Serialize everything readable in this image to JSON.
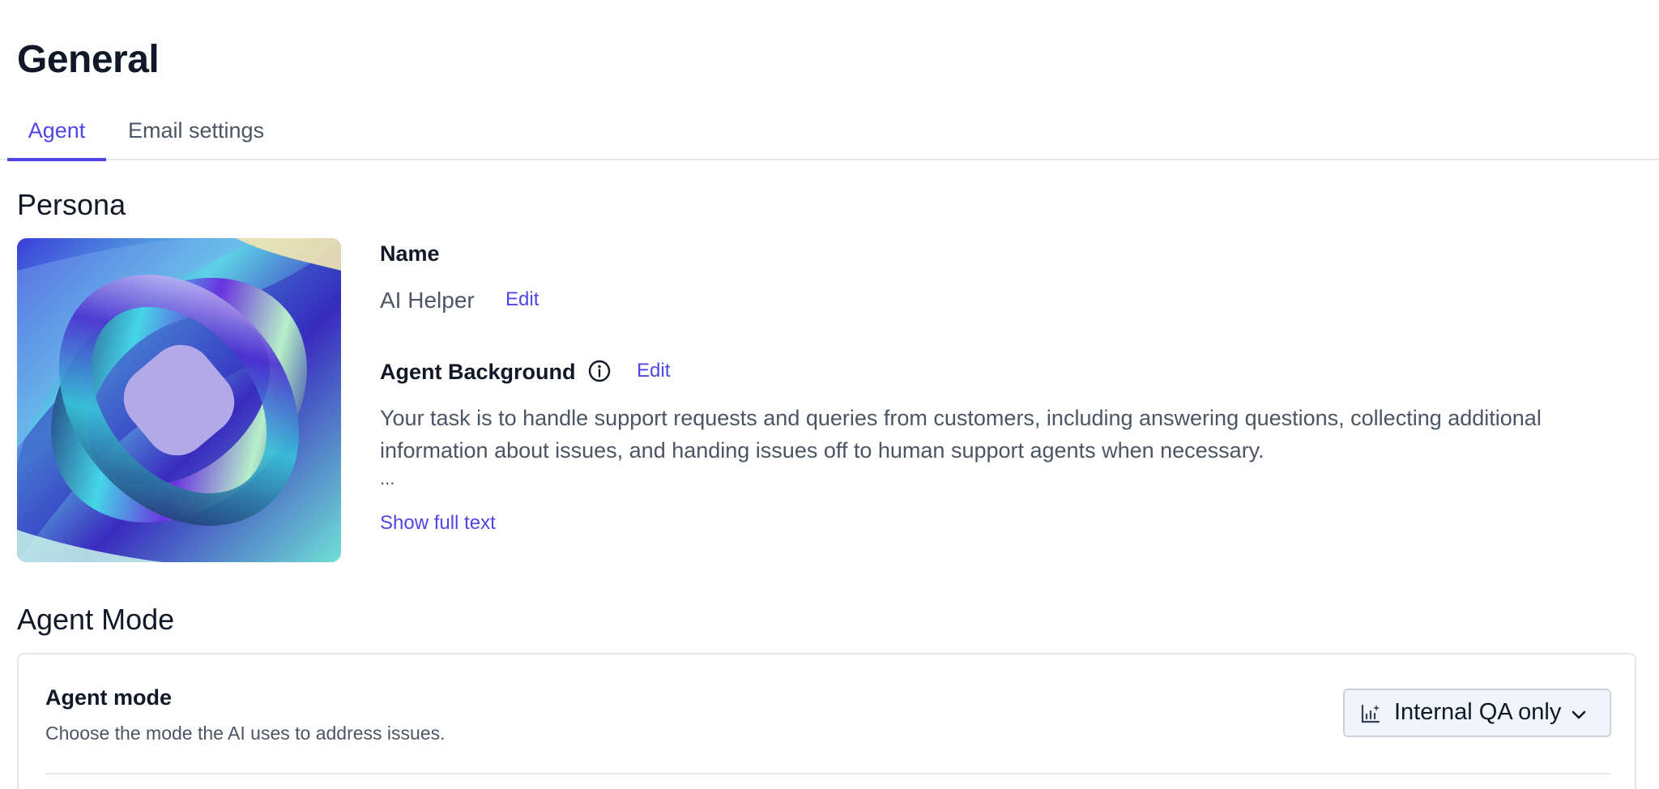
{
  "page": {
    "title": "General"
  },
  "tabs": [
    {
      "label": "Agent",
      "active": true
    },
    {
      "label": "Email settings",
      "active": false
    }
  ],
  "persona": {
    "section_title": "Persona",
    "avatar_icon": "abstract-iridescent-knot-image",
    "name_label": "Name",
    "name_value": "AI Helper",
    "name_edit": "Edit",
    "background_label": "Agent Background",
    "background_info_icon": "info-icon",
    "background_edit": "Edit",
    "background_text": "Your task is to handle support requests and queries from customers, including answering questions, collecting additional information about issues, and handing issues off to human support agents when necessary.",
    "background_ellipsis": "...",
    "show_full_text": "Show full text"
  },
  "agent_mode": {
    "section_title": "Agent Mode",
    "label": "Agent mode",
    "description": "Choose the mode the AI uses to address issues.",
    "selected_value": "Internal QA only",
    "select_icon": "chart-sparkle-icon",
    "chevron_icon": "chevron-down-icon"
  },
  "colors": {
    "accent": "#4f46e5",
    "text_primary": "#111827",
    "text_secondary": "#4b5563",
    "border": "#e5e7eb"
  }
}
